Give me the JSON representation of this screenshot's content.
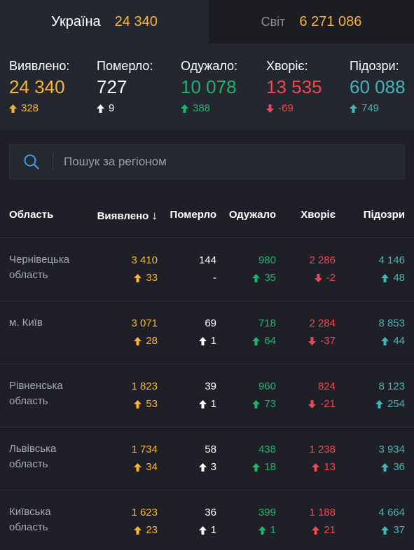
{
  "tabs": {
    "ukraine": {
      "label": "Україна",
      "value": "24 340"
    },
    "world": {
      "label": "Світ",
      "value": "6 271 086"
    }
  },
  "summary": [
    {
      "label": "Виявлено:",
      "value": "24 340",
      "delta": "328",
      "color": "#f9b534",
      "arrow": "up"
    },
    {
      "label": "Померло:",
      "value": "727",
      "delta": "9",
      "color": "#ffffff",
      "arrow": "up"
    },
    {
      "label": "Одужало:",
      "value": "10 078",
      "delta": "388",
      "color": "#21b36c",
      "arrow": "up"
    },
    {
      "label": "Хворіє:",
      "value": "13 535",
      "delta": "-69",
      "color": "#f0474e",
      "arrow": "down"
    },
    {
      "label": "Підозри:",
      "value": "60 088",
      "delta": "749",
      "color": "#47b3b6",
      "arrow": "up"
    }
  ],
  "search": {
    "placeholder": "Пошук за регіоном",
    "value": ""
  },
  "table": {
    "headers": {
      "region": "Область",
      "detected": "Виявлено",
      "sort_indicator": "↓",
      "died": "Померло",
      "recovered": "Одужало",
      "sick": "Хворіє",
      "suspected": "Підозри"
    },
    "rows": [
      {
        "region_line1": "Чернівецька",
        "region_line2": "область",
        "detected": "3 410",
        "detected_delta": "33",
        "died": "144",
        "died_delta": "-",
        "recovered": "980",
        "recovered_delta": "35",
        "sick": "2 286",
        "sick_delta": "-2",
        "suspected": "4 146",
        "suspected_delta": "48"
      },
      {
        "region_line1": "м. Київ",
        "region_line2": "",
        "detected": "3 071",
        "detected_delta": "28",
        "died": "69",
        "died_delta": "1",
        "recovered": "718",
        "recovered_delta": "64",
        "sick": "2 284",
        "sick_delta": "-37",
        "suspected": "8 853",
        "suspected_delta": "44"
      },
      {
        "region_line1": "Рівненська",
        "region_line2": "область",
        "detected": "1 823",
        "detected_delta": "53",
        "died": "39",
        "died_delta": "1",
        "recovered": "960",
        "recovered_delta": "73",
        "sick": "824",
        "sick_delta": "-21",
        "suspected": "8 123",
        "suspected_delta": "254"
      },
      {
        "region_line1": "Львівська",
        "region_line2": "область",
        "detected": "1 734",
        "detected_delta": "34",
        "died": "58",
        "died_delta": "3",
        "recovered": "438",
        "recovered_delta": "18",
        "sick": "1 238",
        "sick_delta": "13",
        "suspected": "3 934",
        "suspected_delta": "36"
      },
      {
        "region_line1": "Київська",
        "region_line2": "область",
        "detected": "1 623",
        "detected_delta": "23",
        "died": "36",
        "died_delta": "1",
        "recovered": "399",
        "recovered_delta": "1",
        "sick": "1 188",
        "sick_delta": "21",
        "suspected": "4 664",
        "suspected_delta": "37"
      }
    ]
  }
}
